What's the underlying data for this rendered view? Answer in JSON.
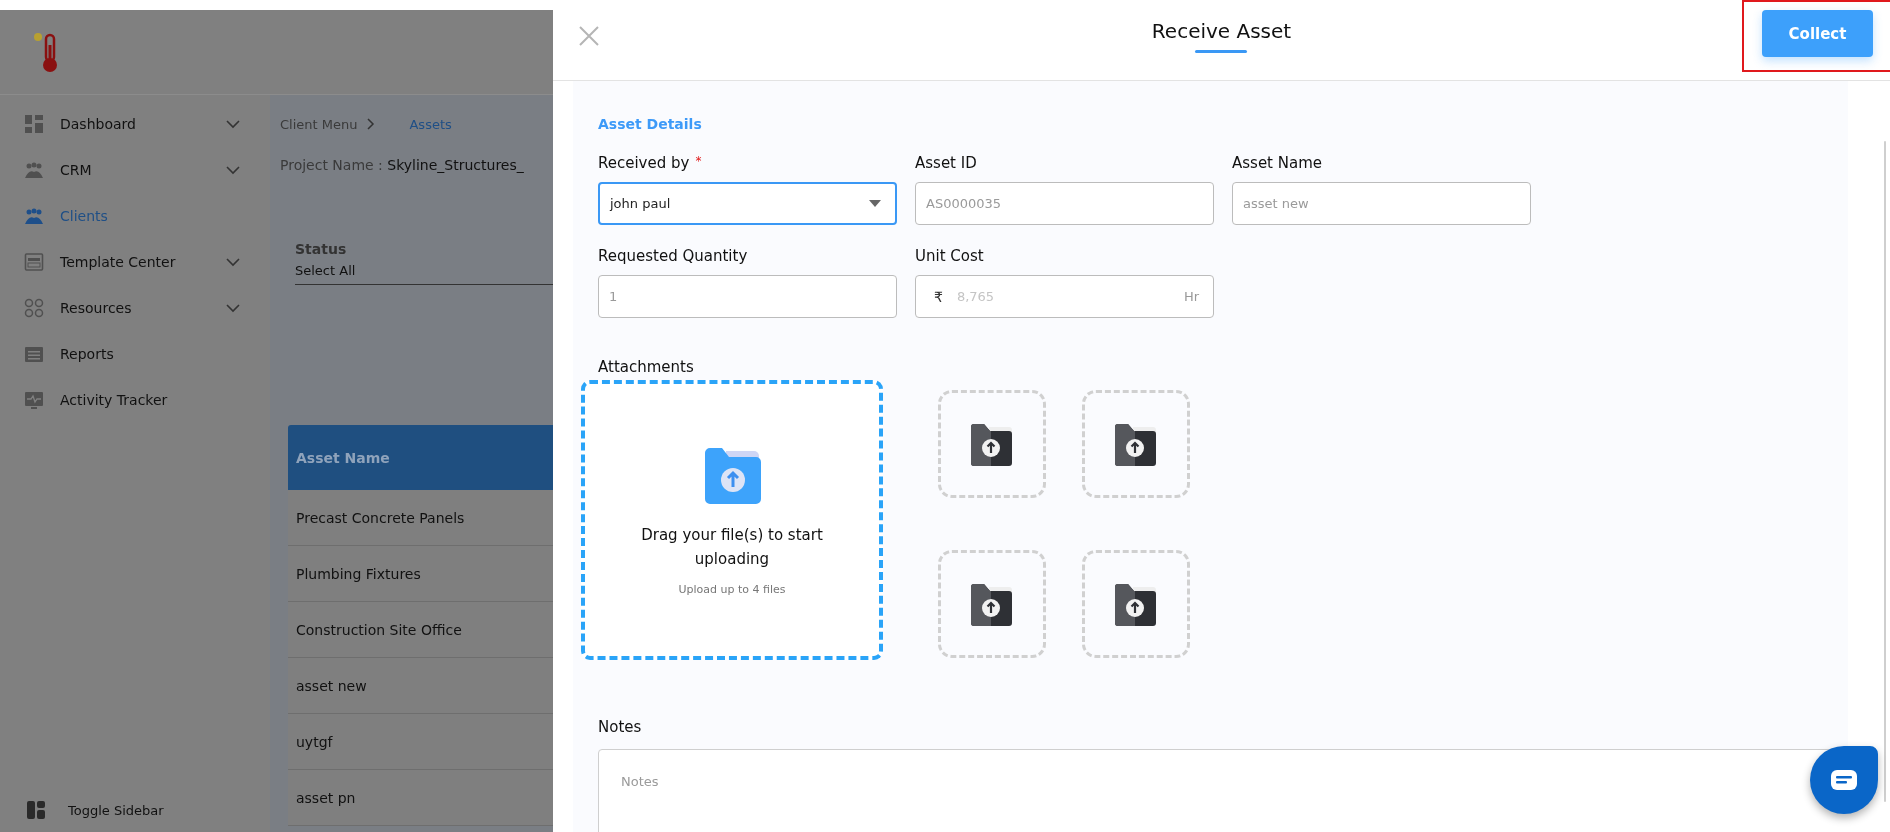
{
  "sidebar": {
    "items": [
      {
        "label": "Dashboard",
        "selected": false,
        "expandable": true
      },
      {
        "label": "CRM",
        "selected": false,
        "expandable": true
      },
      {
        "label": "Clients",
        "selected": true,
        "expandable": false
      },
      {
        "label": "Template Center",
        "selected": false,
        "expandable": true
      },
      {
        "label": "Resources",
        "selected": false,
        "expandable": true
      },
      {
        "label": "Reports",
        "selected": false,
        "expandable": false
      },
      {
        "label": "Activity Tracker",
        "selected": false,
        "expandable": false
      }
    ],
    "toggle": "Toggle Sidebar"
  },
  "breadcrumb": [
    {
      "label": "Client Menu",
      "selected": false
    },
    {
      "label": "Assets",
      "selected": true
    }
  ],
  "project": {
    "label": "Project Name :",
    "value": "Skyline_Structures_"
  },
  "status_filter": {
    "label": "Status",
    "value": "Select All"
  },
  "table": {
    "columns": [
      "Asset Name"
    ],
    "rows": [
      {
        "asset_name": "Precast Concrete Panels"
      },
      {
        "asset_name": "Plumbing Fixtures"
      },
      {
        "asset_name": "Construction Site Office"
      },
      {
        "asset_name": "asset new"
      },
      {
        "asset_name": "uytgf"
      },
      {
        "asset_name": "asset pn"
      }
    ]
  },
  "modal": {
    "title": "Receive Asset",
    "collect_button": {
      "label": "Collect",
      "highlighted": true
    },
    "section_title": "Asset Details",
    "fields": [
      {
        "kind": "select",
        "label": "Received by",
        "required_mark": "*",
        "value": "john paul",
        "focused": true,
        "disabled": false
      },
      {
        "kind": "text",
        "label": "Asset ID",
        "value": "AS0000035",
        "focused": false,
        "disabled": true
      },
      {
        "kind": "text",
        "label": "Asset Name",
        "value": "asset new",
        "focused": false,
        "disabled": true
      },
      {
        "kind": "text",
        "label": "Requested Quantity",
        "value": "1",
        "focused": false,
        "disabled": true
      },
      {
        "kind": "currency",
        "label": "Unit Cost",
        "prefix": "₹",
        "value": "8,765",
        "suffix": "Hr",
        "focused": false,
        "disabled": true
      }
    ],
    "attachments": {
      "label": "Attachments",
      "drop_text": "Drag your file(s) to start uploading",
      "hint": "Upload up to 4 files",
      "slots": [
        {
          "kind": "empty"
        },
        {
          "kind": "empty"
        },
        {
          "kind": "empty"
        },
        {
          "kind": "empty"
        }
      ]
    },
    "notes": {
      "label": "Notes",
      "placeholder": "Notes"
    }
  }
}
